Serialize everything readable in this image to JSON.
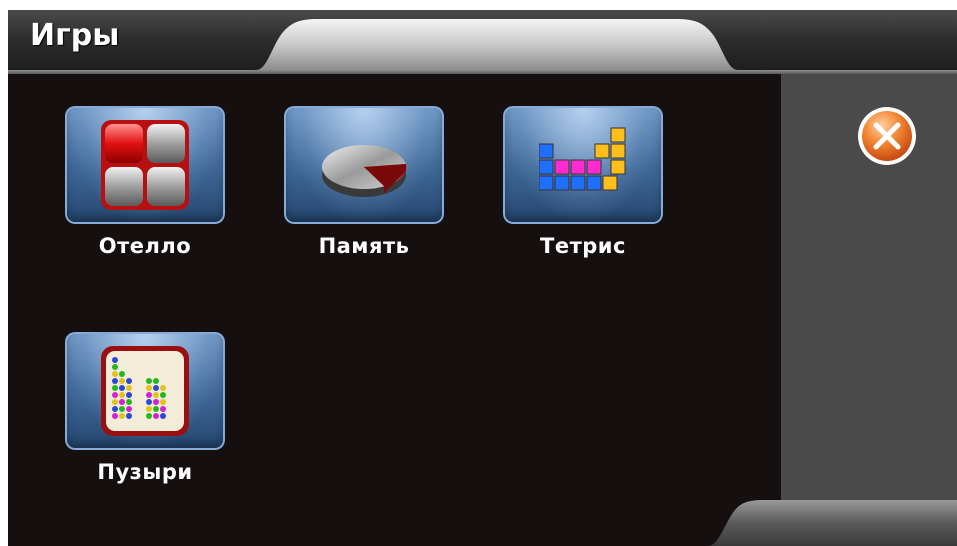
{
  "window": {
    "title": "Игры"
  },
  "games": [
    {
      "label": "Отелло",
      "icon": "othello-icon"
    },
    {
      "label": "Память",
      "icon": "memory-icon"
    },
    {
      "label": "Тетрис",
      "icon": "tetris-icon"
    },
    {
      "label": "Пузыри",
      "icon": "bubbles-icon"
    }
  ],
  "side_panel": {
    "close_icon": "close-icon"
  },
  "colors": {
    "background": "#160f0f",
    "side_panel": "#4a4a4a",
    "tile_blue": "#3e6796",
    "close_orange": "#f07a2a"
  }
}
